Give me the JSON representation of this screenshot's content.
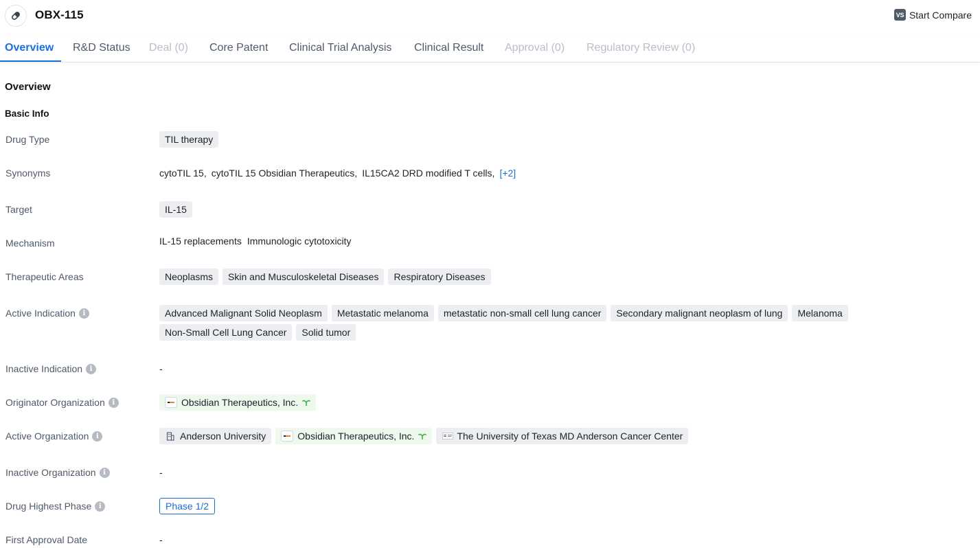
{
  "header": {
    "title": "OBX-115",
    "drug_icon": "pill-icon",
    "compare_icon_text": "VS",
    "compare_label": "Start Compare"
  },
  "tabs": [
    {
      "label": "Overview",
      "state": "active"
    },
    {
      "label": "R&D Status",
      "state": "normal"
    },
    {
      "label": "Deal (0)",
      "state": "disabled"
    },
    {
      "label": "Core Patent",
      "state": "normal"
    },
    {
      "label": "Clinical Trial Analysis",
      "state": "normal"
    },
    {
      "label": "Clinical Result",
      "state": "normal"
    },
    {
      "label": "Approval (0)",
      "state": "disabled"
    },
    {
      "label": "Regulatory Review (0)",
      "state": "disabled"
    }
  ],
  "overview": {
    "section_title": "Overview",
    "basic_info_title": "Basic Info",
    "fields": {
      "drug_type": {
        "label": "Drug Type",
        "tags": [
          "TIL therapy"
        ]
      },
      "synonyms": {
        "label": "Synonyms",
        "items": [
          "cytoTIL 15,",
          "cytoTIL 15 Obsidian Therapeutics,",
          "IL15CA2 DRD modified T cells,"
        ],
        "more": "[+2]"
      },
      "target": {
        "label": "Target",
        "tags": [
          "IL-15"
        ]
      },
      "mechanism": {
        "label": "Mechanism",
        "items": [
          "IL-15 replacements",
          "Immunologic cytotoxicity"
        ]
      },
      "therapeutic_areas": {
        "label": "Therapeutic Areas",
        "tags": [
          "Neoplasms",
          "Skin and Musculoskeletal Diseases",
          "Respiratory Diseases"
        ]
      },
      "active_indication": {
        "label": "Active Indication",
        "tags": [
          "Advanced Malignant Solid Neoplasm",
          "Metastatic melanoma",
          "metastatic non-small cell lung cancer",
          "Secondary malignant neoplasm of lung",
          "Melanoma",
          "Non-Small Cell Lung Cancer",
          "Solid tumor"
        ]
      },
      "inactive_indication": {
        "label": "Inactive Indication",
        "value": "-"
      },
      "originator_organization": {
        "label": "Originator Organization",
        "orgs": [
          {
            "name": "Obsidian Therapeutics, Inc.",
            "type": "company",
            "badge": "sprout-icon"
          }
        ]
      },
      "active_organization": {
        "label": "Active Organization",
        "orgs": [
          {
            "name": "Anderson University",
            "type": "institution"
          },
          {
            "name": "Obsidian Therapeutics, Inc.",
            "type": "company",
            "badge": "sprout-icon"
          },
          {
            "name": "The University of Texas MD Anderson Cancer Center",
            "type": "institution-logo"
          }
        ]
      },
      "inactive_organization": {
        "label": "Inactive Organization",
        "value": "-"
      },
      "drug_highest_phase": {
        "label": "Drug Highest Phase",
        "value": "Phase 1/2"
      },
      "first_approval_date": {
        "label": "First Approval Date",
        "value": "-"
      }
    }
  },
  "colors": {
    "accent": "#1a6fd8",
    "tag_bg": "#eceef2",
    "org_green_bg": "#eef8ec",
    "label": "#4e5969",
    "disabled": "#b8bec8"
  }
}
